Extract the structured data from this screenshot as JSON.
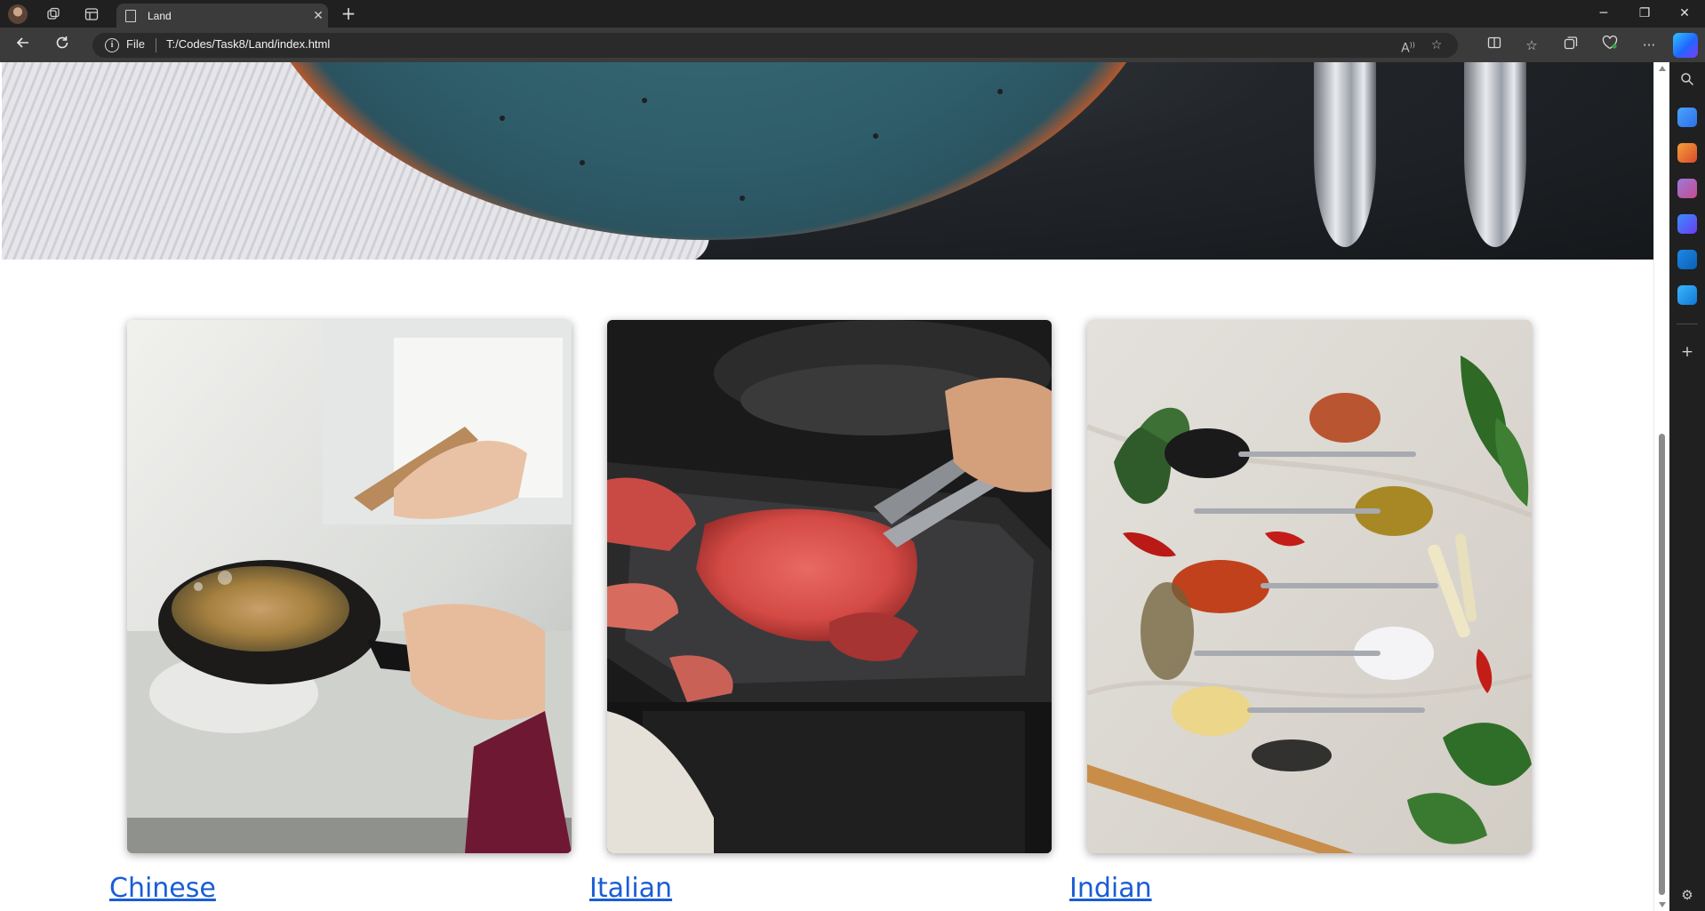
{
  "browser": {
    "tab_title": "Land",
    "address_scheme": "File",
    "address_url": "T:/Codes/Task8/Land/index.html"
  },
  "page": {
    "cuisines": [
      {
        "label": "Chinese",
        "photo": "wok-stir-fry-photo"
      },
      {
        "label": "Italian",
        "photo": "steak-grilling-photo"
      },
      {
        "label": "Indian",
        "photo": "spices-spoons-photo"
      }
    ]
  },
  "colors": {
    "link": "#1a5dd6",
    "chrome_dark": "#202020",
    "chrome_mid": "#3b3b3b"
  }
}
